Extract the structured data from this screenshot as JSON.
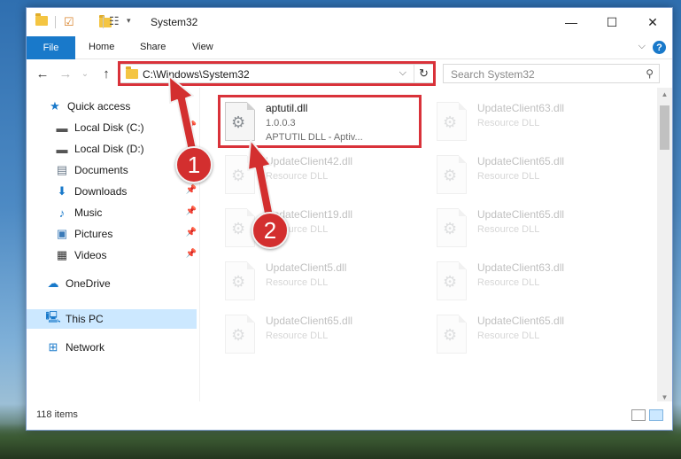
{
  "window": {
    "title": "System32"
  },
  "ribbon": {
    "file": "File",
    "home": "Home",
    "share": "Share",
    "view": "View"
  },
  "address": {
    "path": "C:\\Windows\\System32"
  },
  "search": {
    "placeholder": "Search System32"
  },
  "sidebar": {
    "items": [
      {
        "label": "Quick access",
        "icon": "star-icon"
      },
      {
        "label": "Local Disk (C:)",
        "icon": "drive-icon"
      },
      {
        "label": "Local Disk (D:)",
        "icon": "drive-icon"
      },
      {
        "label": "Documents",
        "icon": "documents-icon"
      },
      {
        "label": "Downloads",
        "icon": "downloads-icon"
      },
      {
        "label": "Music",
        "icon": "music-icon"
      },
      {
        "label": "Pictures",
        "icon": "pictures-icon"
      },
      {
        "label": "Videos",
        "icon": "videos-icon"
      },
      {
        "label": "OneDrive",
        "icon": "onedrive-icon"
      },
      {
        "label": "This PC",
        "icon": "computer-icon"
      },
      {
        "label": "Network",
        "icon": "network-icon"
      }
    ]
  },
  "files": [
    {
      "name": "aptutil.dll",
      "version": "1.0.0.3",
      "desc": "APTUTIL DLL - Aptiv..."
    },
    {
      "name": "UpdateClient63.dll",
      "desc": "Resource DLL"
    },
    {
      "name": "UpdateClient42.dll",
      "desc": "Resource DLL"
    },
    {
      "name": "UpdateClient65.dll",
      "desc": "Resource DLL"
    },
    {
      "name": "UpdateClient19.dll",
      "desc": "Resource DLL"
    },
    {
      "name": "UpdateClient65.dll",
      "desc": "Resource DLL"
    },
    {
      "name": "UpdateClient5.dll",
      "desc": "Resource DLL"
    },
    {
      "name": "UpdateClient63.dll",
      "desc": "Resource DLL"
    },
    {
      "name": "UpdateClient65.dll",
      "desc": "Resource DLL"
    },
    {
      "name": "UpdateClient65.dll",
      "desc": "Resource DLL"
    }
  ],
  "status": {
    "items": "118 items"
  },
  "callouts": {
    "one": "1",
    "two": "2"
  },
  "colors": {
    "accent": "#1979ca",
    "highlight": "#d9323a",
    "selected": "#cce8ff"
  }
}
